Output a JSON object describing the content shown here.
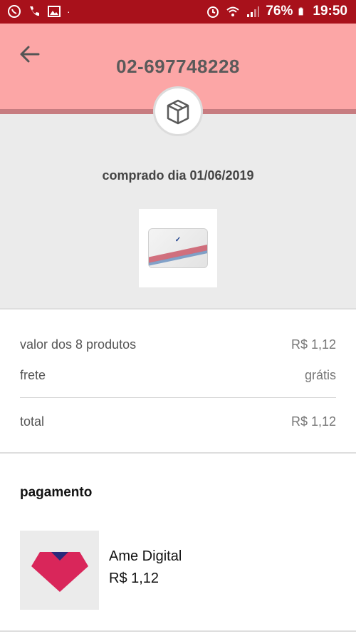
{
  "status_bar": {
    "battery": "76%",
    "time": "19:50"
  },
  "header": {
    "order_number": "02-697748228"
  },
  "order": {
    "purchase_date": "comprado dia 01/06/2019",
    "product_image_icon": "rexona-soap-product"
  },
  "summary": {
    "products_label": "valor dos 8 produtos",
    "products_value": "R$ 1,12",
    "shipping_label": "frete",
    "shipping_value": "grátis",
    "total_label": "total",
    "total_value": "R$ 1,12"
  },
  "payment": {
    "title": "pagamento",
    "method_name": "Ame Digital",
    "amount": "R$ 1,12"
  },
  "colors": {
    "status_bar": "#a8111b",
    "header": "#fca6a6",
    "ame_pink": "#d9265a",
    "ame_navy": "#2a2a7a"
  }
}
